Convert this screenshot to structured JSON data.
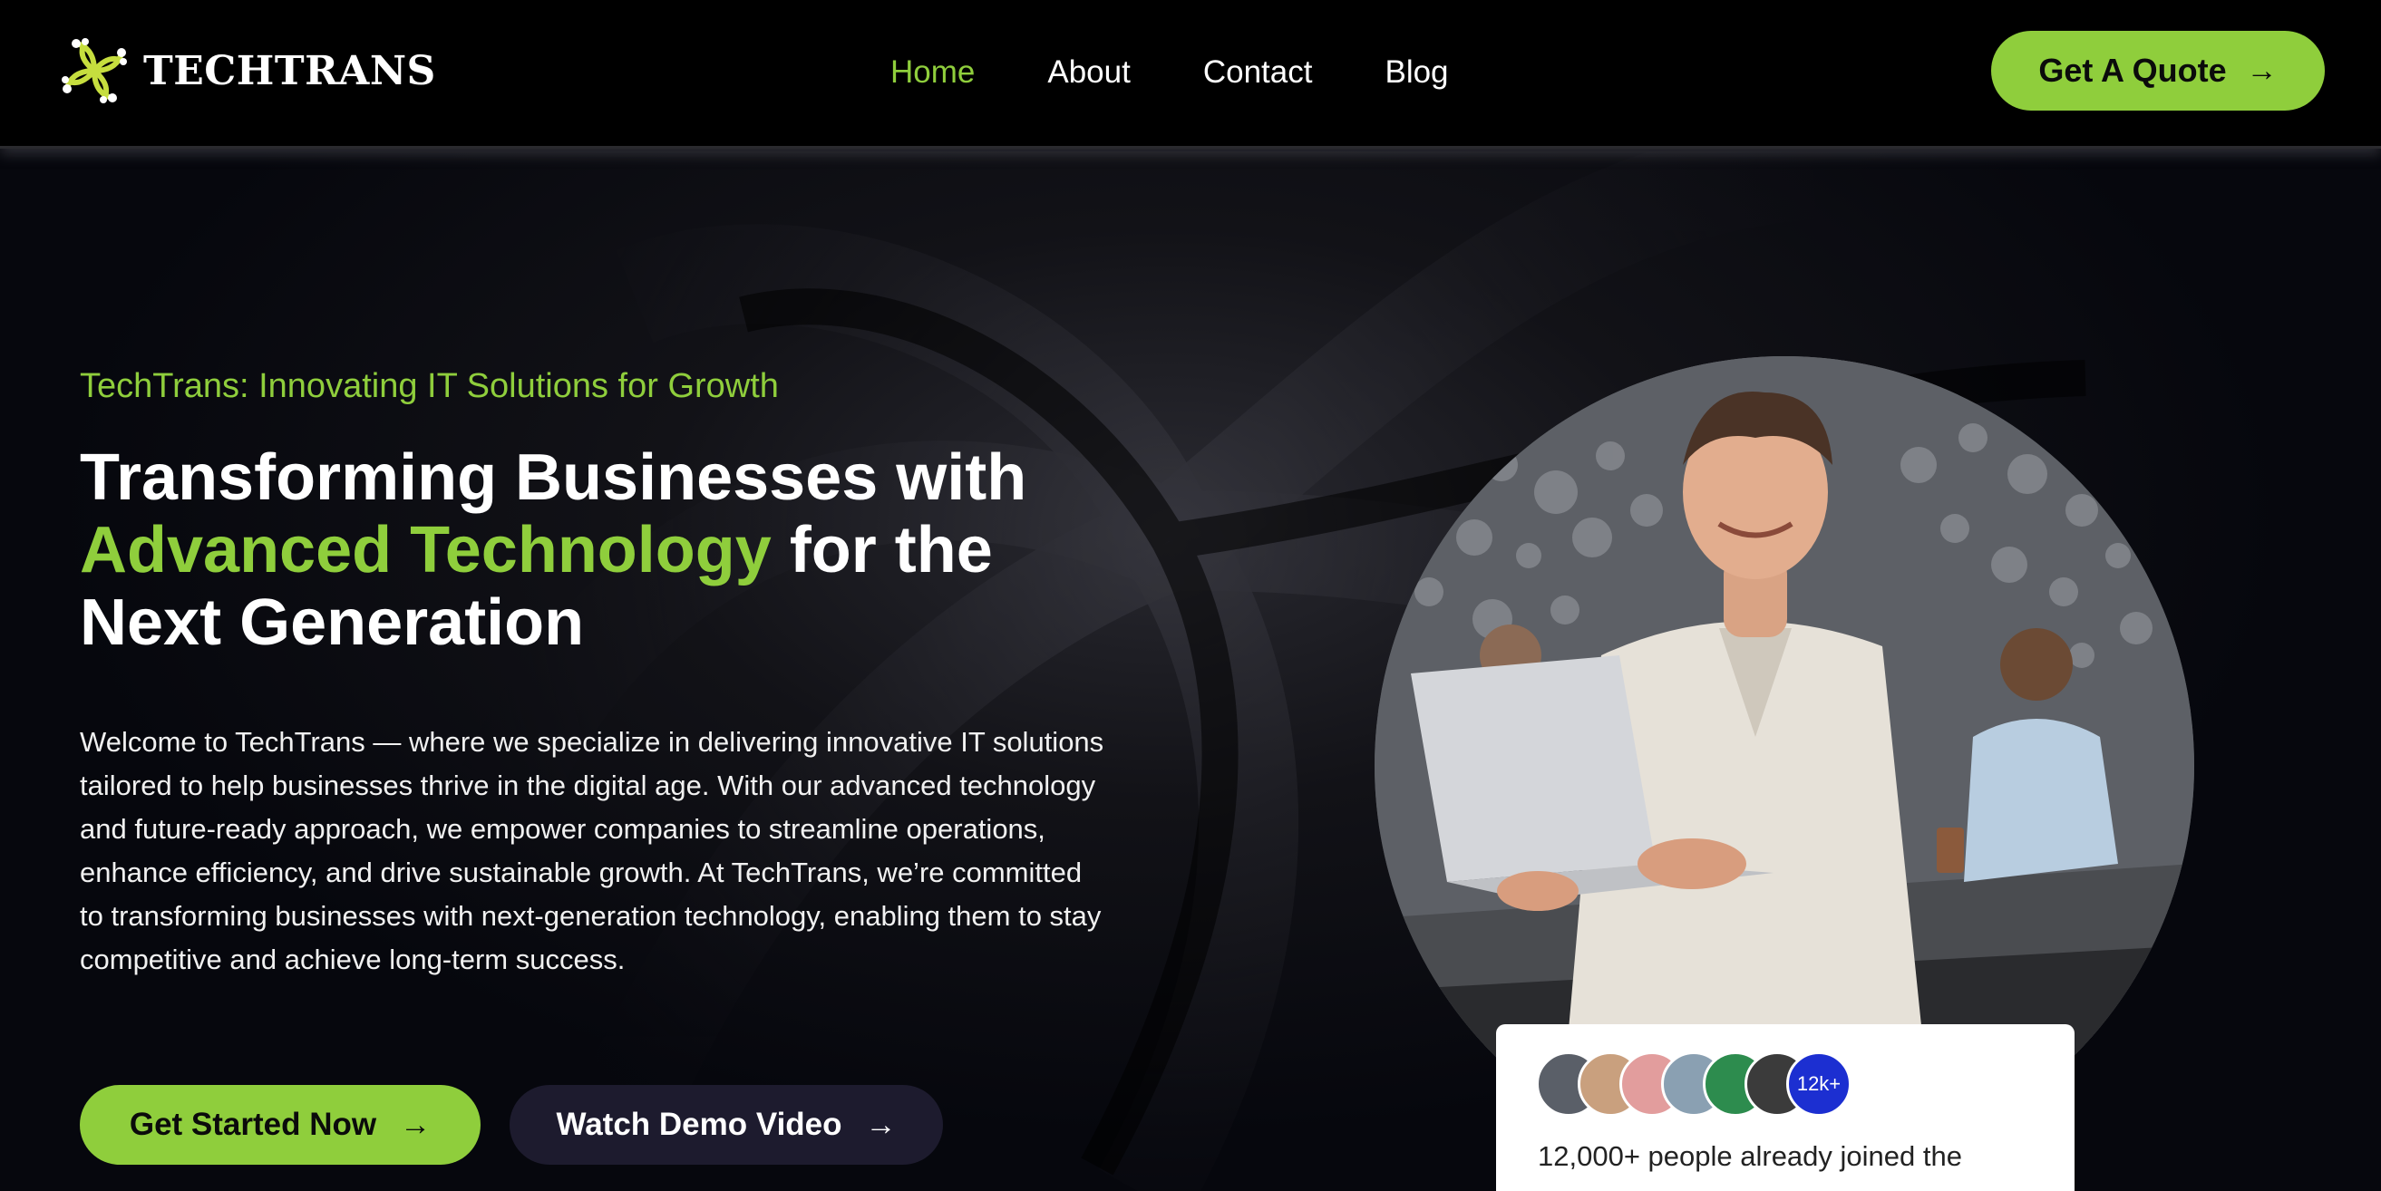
{
  "brand": {
    "name": "TECHTRANS"
  },
  "nav": {
    "items": [
      {
        "label": "Home",
        "active": true
      },
      {
        "label": "About",
        "active": false
      },
      {
        "label": "Contact",
        "active": false
      },
      {
        "label": "Blog",
        "active": false
      }
    ],
    "cta_label": "Get A Quote"
  },
  "hero": {
    "tagline": "TechTrans: Innovating IT Solutions for Growth",
    "headline_part1": "Transforming Businesses with",
    "headline_accent": "Advanced Technology",
    "headline_part2": "for the",
    "headline_part3": "Next Generation",
    "description": "Welcome to TechTrans — where we specialize in delivering innovative IT solutions tailored to help businesses thrive in the digital age. With our advanced technology and future-ready approach, we empower companies to streamline operations, enhance efficiency, and drive sustainable growth. At TechTrans, we’re committed to transforming businesses with next-generation technology, enabling them to stay competitive and achieve long-term success.",
    "primary_button": "Get Started Now",
    "secondary_button": "Watch Demo Video",
    "arrow_icon": "arrow-right-icon"
  },
  "social_proof": {
    "badge": "12k+",
    "text": "12,000+ people already joined the"
  },
  "colors": {
    "accent": "#8fce3c",
    "background": "#05060c",
    "demo_button": "#1d1b2e",
    "badge": "#1c2fd1"
  }
}
